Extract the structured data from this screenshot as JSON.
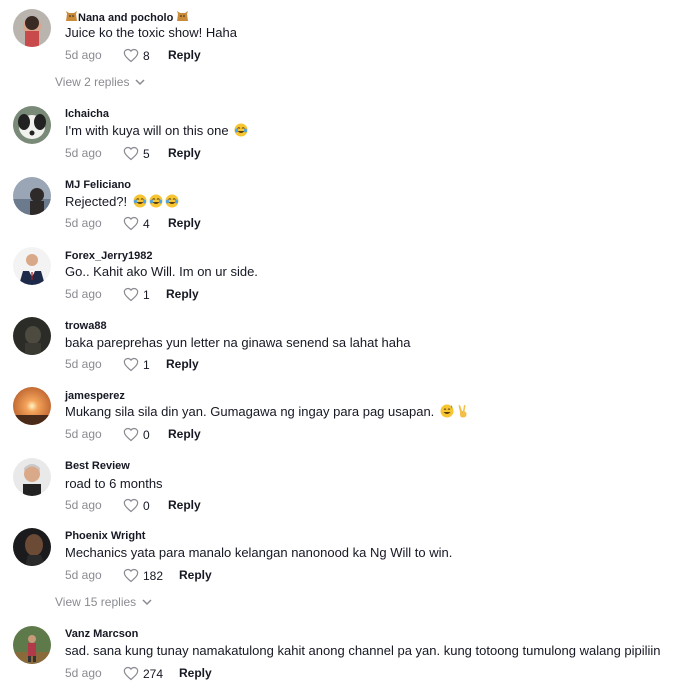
{
  "comments": [
    {
      "username": "Nana and pocholo",
      "text": "Juice ko the toxic show! Haha",
      "date": "5d ago",
      "likes": "8",
      "reply": "Reply"
    },
    {
      "username": "lchaicha",
      "text": "I'm with kuya will on this one",
      "date": "5d ago",
      "likes": "5",
      "reply": "Reply"
    },
    {
      "username": "MJ Feliciano",
      "text": "Rejected?!",
      "date": "5d ago",
      "likes": "4",
      "reply": "Reply"
    },
    {
      "username": "Forex_Jerry1982",
      "text": "Go.. Kahit ako Will. Im on ur side.",
      "date": "5d ago",
      "likes": "1",
      "reply": "Reply"
    },
    {
      "username": "trowa88",
      "text": "baka pareprehas yun letter na ginawa senend sa lahat haha",
      "date": "5d ago",
      "likes": "1",
      "reply": "Reply"
    },
    {
      "username": "jamesperez",
      "text": "Mukang sila sila din yan. Gumagawa ng ingay para pag usapan.",
      "date": "5d ago",
      "likes": "0",
      "reply": "Reply"
    },
    {
      "username": "Best Review",
      "text": "road to 6 months",
      "date": "5d ago",
      "likes": "0",
      "reply": "Reply"
    },
    {
      "username": "Phoenix Wright",
      "text": "Mechanics yata para manalo kelangan nanonood ka Ng Will to win.",
      "date": "5d ago",
      "likes": "182",
      "reply": "Reply"
    },
    {
      "username": "Vanz Marcson",
      "text": "sad. sana kung tunay namakatulong kahit anong channel pa yan. kung totoong tumulong walang pipiliin",
      "date": "5d ago",
      "likes": "274",
      "reply": "Reply"
    }
  ],
  "view_replies": [
    {
      "label": "View 2 replies"
    },
    {
      "label": "View 15 replies"
    }
  ],
  "colors": {
    "text": "#161823",
    "muted": "#8a8b91"
  },
  "icons": {
    "like": "heart-outline-icon",
    "expand": "chevron-down-icon",
    "laugh": "face-with-tears-of-joy-emoji",
    "sweat": "grinning-sweat-emoji",
    "victory": "victory-hand-emoji",
    "cat": "cat-emoji"
  }
}
